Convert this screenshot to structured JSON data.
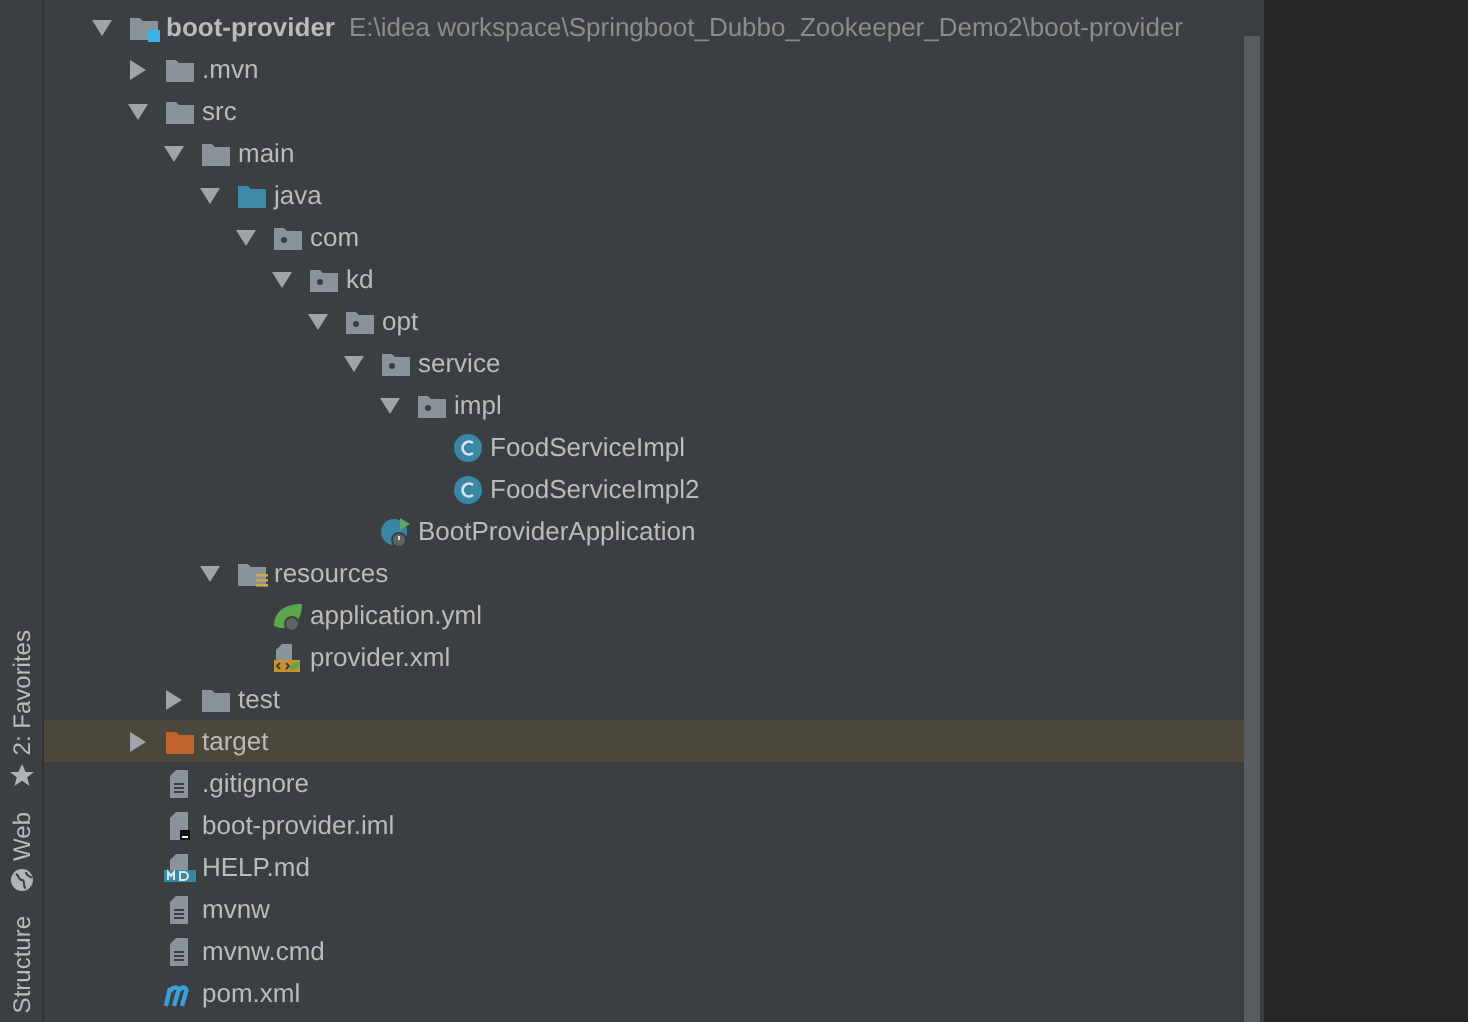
{
  "side_tools": [
    {
      "label": "2: Favorites",
      "kind": "star"
    },
    {
      "label": "Web",
      "kind": "globe"
    },
    {
      "label": "Structure",
      "kind": "none"
    }
  ],
  "tree": [
    {
      "label": "boot-provider",
      "path": "E:\\idea workspace\\Springboot_Dubbo_Zookeeper_Demo2\\boot-provider",
      "kind": "module",
      "expanded": true,
      "selected": false,
      "children": [
        {
          "label": ".mvn",
          "kind": "folder",
          "expanded": false,
          "selected": false
        },
        {
          "label": "src",
          "kind": "folder",
          "expanded": true,
          "selected": false,
          "children": [
            {
              "label": "main",
              "kind": "folder",
              "expanded": true,
              "selected": false,
              "children": [
                {
                  "label": "java",
                  "kind": "source",
                  "expanded": true,
                  "selected": false,
                  "children": [
                    {
                      "label": "com",
                      "kind": "package",
                      "expanded": true,
                      "selected": false,
                      "children": [
                        {
                          "label": "kd",
                          "kind": "package",
                          "expanded": true,
                          "selected": false,
                          "children": [
                            {
                              "label": "opt",
                              "kind": "package",
                              "expanded": true,
                              "selected": false,
                              "children": [
                                {
                                  "label": "service",
                                  "kind": "package",
                                  "expanded": true,
                                  "selected": false,
                                  "children": [
                                    {
                                      "label": "impl",
                                      "kind": "package",
                                      "expanded": true,
                                      "selected": false,
                                      "children": [
                                        {
                                          "label": "FoodServiceImpl",
                                          "kind": "class",
                                          "selected": false
                                        },
                                        {
                                          "label": "FoodServiceImpl2",
                                          "kind": "class",
                                          "selected": false
                                        }
                                      ]
                                    }
                                  ]
                                },
                                {
                                  "label": "BootProviderApplication",
                                  "kind": "boot-class",
                                  "selected": false
                                }
                              ]
                            }
                          ]
                        }
                      ]
                    }
                  ]
                },
                {
                  "label": "resources",
                  "kind": "resources",
                  "expanded": true,
                  "selected": false,
                  "children": [
                    {
                      "label": "application.yml",
                      "kind": "yml",
                      "selected": false
                    },
                    {
                      "label": "provider.xml",
                      "kind": "xml",
                      "selected": false
                    }
                  ]
                }
              ]
            },
            {
              "label": "test",
              "kind": "folder",
              "expanded": false,
              "selected": false
            }
          ]
        },
        {
          "label": "target",
          "kind": "excluded",
          "expanded": false,
          "selected": true
        },
        {
          "label": ".gitignore",
          "kind": "text",
          "selected": false
        },
        {
          "label": "boot-provider.iml",
          "kind": "iml",
          "selected": false
        },
        {
          "label": "HELP.md",
          "kind": "md",
          "selected": false
        },
        {
          "label": "mvnw",
          "kind": "text",
          "selected": false
        },
        {
          "label": "mvnw.cmd",
          "kind": "text",
          "selected": false
        },
        {
          "label": "pom.xml",
          "kind": "maven",
          "selected": false
        }
      ]
    }
  ]
}
